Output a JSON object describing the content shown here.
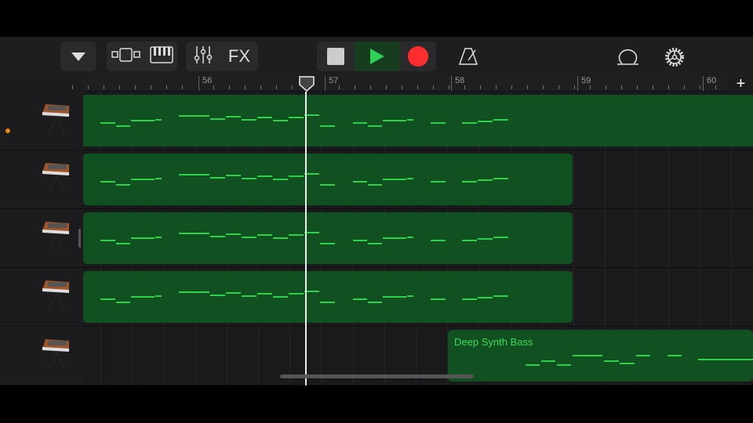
{
  "toolbar": {
    "buttons": [
      {
        "name": "tracks-menu",
        "icon": "triangle-down-icon"
      },
      {
        "name": "view-toggle",
        "icon": "tracks-view-icon"
      },
      {
        "name": "instrument",
        "icon": "keyboard-icon"
      },
      {
        "name": "mixer",
        "icon": "sliders-icon"
      },
      {
        "name": "fx",
        "label": "FX"
      },
      {
        "name": "stop",
        "icon": "stop-icon"
      },
      {
        "name": "play",
        "icon": "play-icon"
      },
      {
        "name": "record",
        "icon": "record-icon"
      },
      {
        "name": "metronome",
        "icon": "metronome-icon"
      },
      {
        "name": "loops",
        "icon": "loop-icon"
      },
      {
        "name": "settings",
        "icon": "gear-icon"
      }
    ],
    "fx_label": "FX"
  },
  "ruler": {
    "bars": [
      "56",
      "57",
      "58",
      "59",
      "60"
    ],
    "add_label": "+"
  },
  "tracks": [
    {
      "instrument": "synth",
      "selected": true
    },
    {
      "instrument": "synth"
    },
    {
      "instrument": "synth"
    },
    {
      "instrument": "synth"
    },
    {
      "instrument": "synth",
      "region_label": "Deep Synth Bass"
    }
  ],
  "colors": {
    "region": "#115021",
    "note": "#2ed14a",
    "record": "#ff2d2d",
    "play": "#30d158",
    "selected_dot": "#f08a00"
  }
}
